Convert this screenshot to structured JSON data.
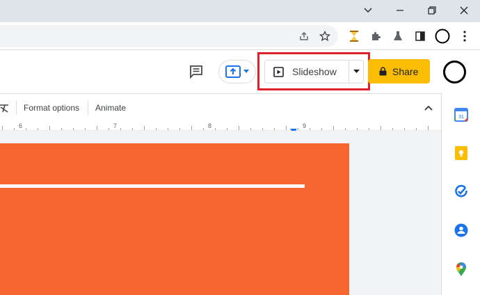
{
  "window": {
    "minimize_glyph": "—",
    "maximize_glyph": "❐",
    "close_glyph": "✕",
    "tablist_glyph": "⌄"
  },
  "header": {
    "slideshow_label": "Slideshow",
    "share_label": "Share"
  },
  "toolbar": {
    "format_options_label": "Format options",
    "animate_label": "Animate"
  },
  "ruler": {
    "numbers": [
      "6",
      "7",
      "8",
      "9"
    ]
  },
  "colors": {
    "slide_background": "#f76531",
    "share_button": "#fbbc04",
    "highlight_box": "#e0202a",
    "present_accent": "#1a73e8"
  },
  "side_panel": {
    "calendar_day": "31",
    "icons": [
      "calendar-icon",
      "keep-icon",
      "tasks-icon",
      "contacts-icon",
      "maps-icon"
    ]
  }
}
